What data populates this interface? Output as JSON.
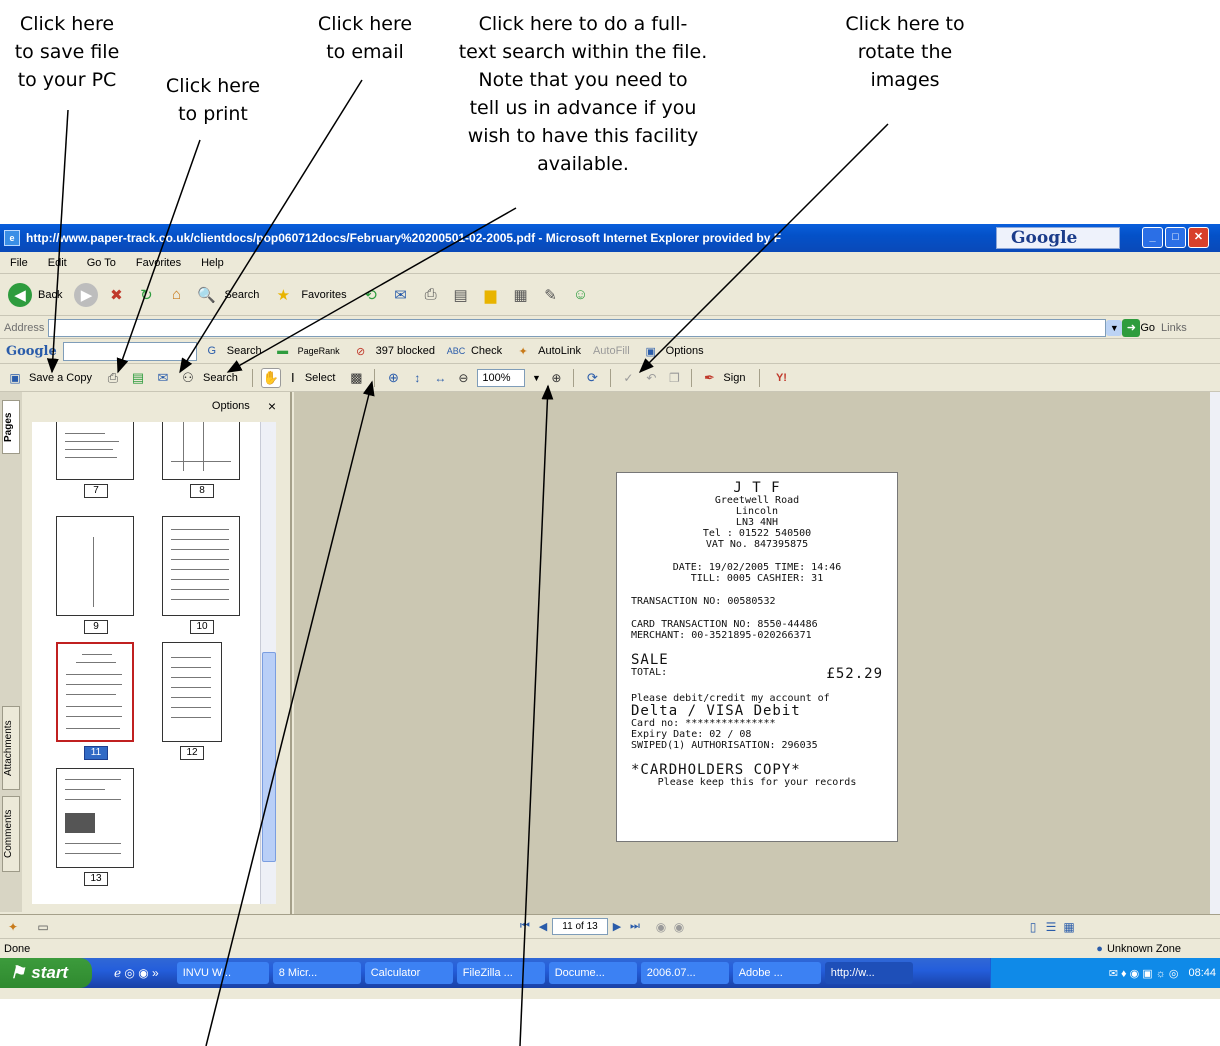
{
  "callouts": {
    "save": [
      "Click here",
      "to save file",
      "to your PC"
    ],
    "print": [
      "Click here",
      "to print"
    ],
    "email": [
      "Click here",
      "to email"
    ],
    "search": [
      "Click here to do a full-",
      "text search within the file.",
      "Note that you need to",
      "tell us in advance if you",
      "wish to have this facility",
      "available."
    ],
    "rotate": [
      "Click here to",
      "rotate the",
      "images"
    ]
  },
  "window": {
    "title": "http://www.paper-track.co.uk/clientdocs/pop060712docs/February%20200501-02-2005.pdf - Microsoft Internet Explorer provided by F",
    "google_logo": "Google"
  },
  "menu": [
    "File",
    "Edit",
    "Go To",
    "Favorites",
    "Help"
  ],
  "ie_toolbar": {
    "back": "Back",
    "search": "Search",
    "favorites": "Favorites"
  },
  "address": {
    "label": "Address",
    "go": "Go",
    "links": "Links"
  },
  "google_toolbar": {
    "logo": "Google",
    "search": "Search",
    "pagerank": "PageRank",
    "blocked": "397 blocked",
    "check": "Check",
    "autolink": "AutoLink",
    "autofill": "AutoFill",
    "options": "Options"
  },
  "acrobat_toolbar": {
    "save_copy": "Save a Copy",
    "search": "Search",
    "select": "Select",
    "zoom": "100%",
    "sign": "Sign"
  },
  "side_tabs": {
    "pages": "Pages",
    "attachments": "Attachments",
    "comments": "Comments"
  },
  "nav_panel": {
    "options": "Options",
    "close": "×",
    "pages": [
      "7",
      "8",
      "9",
      "10",
      "11",
      "12",
      "13"
    ],
    "selected_page": "11"
  },
  "receipt": {
    "store": "J T F",
    "address": [
      "Greetwell Road",
      "Lincoln",
      "LN3 4NH"
    ],
    "tel": "Tel : 01522 540500",
    "vat": "VAT No. 847395875",
    "date_line": "DATE: 19/02/2005 TIME: 14:46",
    "till_line": "TILL: 0005    CASHIER: 31",
    "transaction": "TRANSACTION NO: 00580532",
    "card_transaction": "CARD TRANSACTION NO: 8550-44486",
    "merchant": "MERCHANT: 00-3521895-020266371",
    "sale": "SALE",
    "total_label": "TOTAL:",
    "total_value": "£52.29",
    "debit_line": "Please debit/credit my account of",
    "card_type": "Delta / VISA Debit",
    "card_no": "Card no: ***************",
    "expiry": "Expiry Date: 02 / 08",
    "swiped": "SWIPED(1) AUTHORISATION: 296035",
    "copy": "*CARDHOLDERS COPY*",
    "keep": "Please keep this for your records"
  },
  "page_nav": {
    "page_of": "11 of 13"
  },
  "status": {
    "done": "Done",
    "zone": "Unknown Zone"
  },
  "taskbar": {
    "start": "start",
    "tasks": [
      "INVU W...",
      "8 Micr...",
      "Calculator",
      "FileZilla ...",
      "Docume...",
      "2006.07...",
      "Adobe ...",
      "http://w..."
    ],
    "clock": "08:44"
  }
}
